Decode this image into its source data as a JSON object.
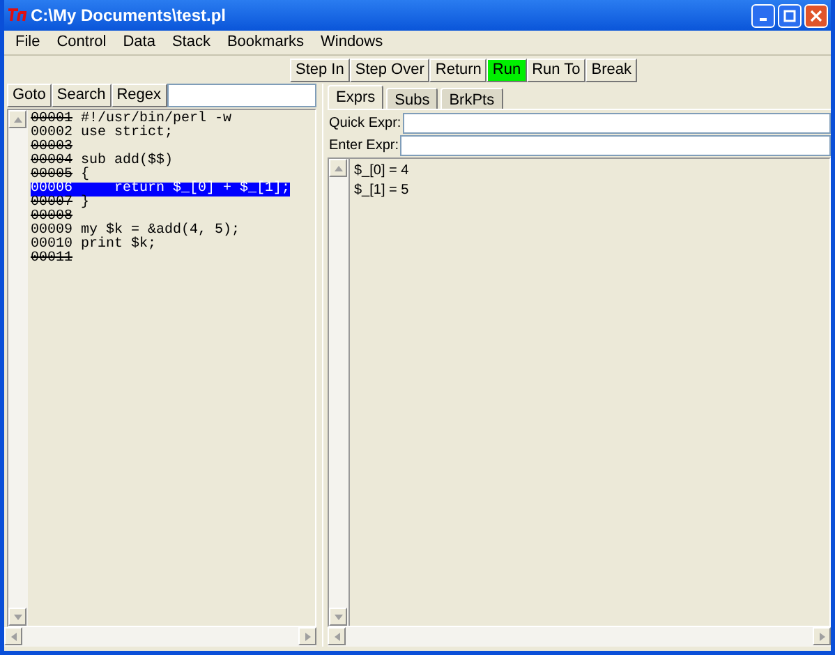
{
  "window": {
    "title": "C:\\My Documents\\test.pl"
  },
  "menu": [
    "File",
    "Control",
    "Data",
    "Stack",
    "Bookmarks",
    "Windows"
  ],
  "toolbar": [
    {
      "label": "Step In",
      "active": false
    },
    {
      "label": "Step Over",
      "active": false
    },
    {
      "label": "Return",
      "active": false
    },
    {
      "label": "Run",
      "active": true
    },
    {
      "label": "Run To",
      "active": false
    },
    {
      "label": "Break",
      "active": false
    }
  ],
  "source": {
    "buttons": [
      "Goto",
      "Search",
      "Regex"
    ],
    "lines": [
      {
        "number": "00001",
        "code": "#!/usr/bin/perl -w",
        "breakable": false,
        "selected": false
      },
      {
        "number": "00002",
        "code": "use strict;",
        "breakable": true,
        "selected": false
      },
      {
        "number": "00003",
        "breakable": false,
        "selected": false
      },
      {
        "number": "00004",
        "code": "sub add($$)",
        "breakable": false,
        "selected": false
      },
      {
        "number": "00005",
        "code": "{",
        "breakable": false,
        "selected": false
      },
      {
        "number": "00006",
        "code": "    return $_[0] + $_[1];",
        "breakable": true,
        "selected": true
      },
      {
        "number": "00007",
        "code": "}",
        "breakable": false,
        "selected": false
      },
      {
        "number": "00008",
        "breakable": false,
        "selected": false
      },
      {
        "number": "00009",
        "code": "my $k = &add(4, 5);",
        "breakable": true,
        "selected": false
      },
      {
        "number": "00010",
        "code": "print $k;",
        "breakable": true,
        "selected": false
      },
      {
        "number": "00011",
        "breakable": false,
        "selected": false
      }
    ]
  },
  "tabs": [
    {
      "label": "Exprs",
      "selected": true
    },
    {
      "label": "Subs",
      "selected": false
    },
    {
      "label": "BrkPts",
      "selected": false
    }
  ],
  "fields": [
    {
      "label": "Quick Expr:"
    },
    {
      "label": "Enter Expr:"
    }
  ],
  "results": [
    "$_[0] = 4",
    "$_[1] = 5"
  ]
}
